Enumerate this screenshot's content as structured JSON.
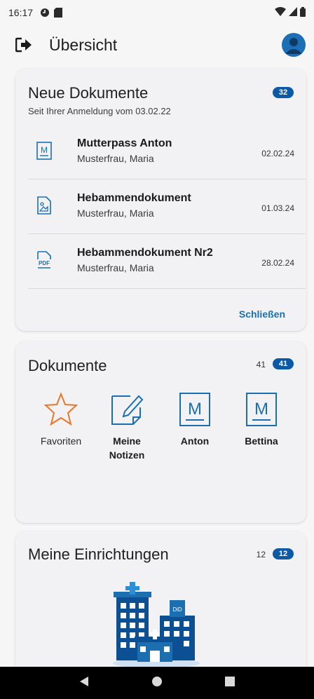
{
  "status_bar": {
    "time": "16:17",
    "icons_left": [
      "sync-icon",
      "sd-card-icon"
    ],
    "icons_right": [
      "wifi-icon",
      "signal-icon",
      "battery-icon"
    ]
  },
  "app_bar": {
    "title": "Übersicht",
    "logout_icon": "logout-icon",
    "avatar_icon": "user-avatar-icon"
  },
  "new_documents": {
    "title": "Neue Dokumente",
    "badge": "32",
    "subtitle": "Seit Ihrer Anmeldung vom 03.02.22",
    "items": [
      {
        "title": "Mutterpass Anton",
        "author": "Musterfrau, Maria",
        "date": "02.02.24",
        "icon": "mutterpass-icon"
      },
      {
        "title": "Hebammendokument",
        "author": "Musterfrau, Maria",
        "date": "01.03.24",
        "icon": "image-document-icon"
      },
      {
        "title": "Hebammendokument Nr2",
        "author": "Musterfrau, Maria",
        "date": "28.02.24",
        "icon": "pdf-document-icon"
      }
    ],
    "close_label": "Schließen"
  },
  "documents": {
    "title": "Dokumente",
    "count": "41",
    "badge": "41",
    "tiles": [
      {
        "label": "Favoriten",
        "icon": "star-icon"
      },
      {
        "label": "Meine Notizen",
        "label_line1": "Meine",
        "label_line2": "Notizen",
        "icon": "note-edit-icon"
      },
      {
        "label": "Anton",
        "icon": "mutterpass-icon"
      },
      {
        "label": "Bettina",
        "icon": "mutterpass-icon"
      }
    ]
  },
  "institutions": {
    "title": "Meine Einrichtungen",
    "count": "12",
    "badge": "12",
    "illustration": "hospital-buildings-illustration",
    "illustration_text": "DiD"
  },
  "nav_bar": {
    "back": "back-icon",
    "home": "home-icon",
    "recents": "recents-icon"
  },
  "colors": {
    "accent": "#1b6fb1",
    "badge": "#0c5aa6",
    "star": "#e8782a",
    "navbar": "#000000"
  }
}
